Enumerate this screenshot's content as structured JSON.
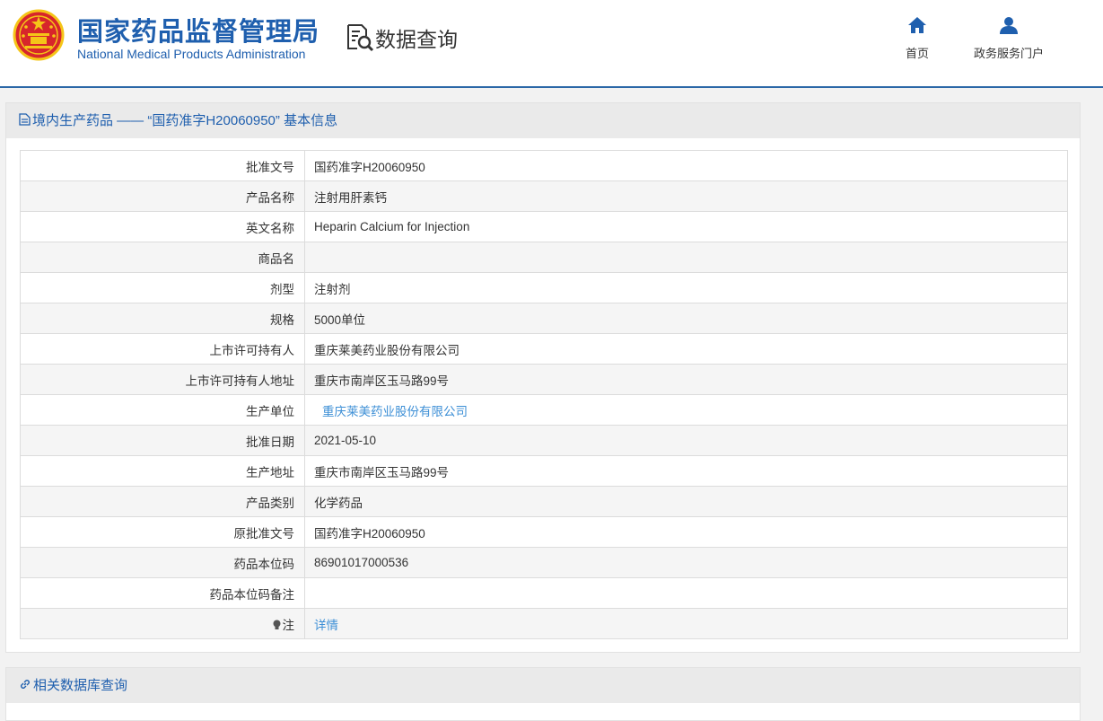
{
  "header": {
    "org_name_cn": "国家药品监督管理局",
    "org_name_en": "National Medical Products Administration",
    "subtitle": "数据查询",
    "nav": [
      {
        "label": "首页",
        "icon": "home-icon"
      },
      {
        "label": "政务服务门户",
        "icon": "user-icon"
      }
    ]
  },
  "detail": {
    "title": "境内生产药品 —— “国药准字H20060950” 基本信息",
    "rows": [
      {
        "label": "批准文号",
        "value": "国药准字H20060950"
      },
      {
        "label": "产品名称",
        "value": "注射用肝素钙"
      },
      {
        "label": "英文名称",
        "value": "Heparin Calcium for Injection"
      },
      {
        "label": "商品名",
        "value": ""
      },
      {
        "label": "剂型",
        "value": "注射剂"
      },
      {
        "label": "规格",
        "value": "5000单位"
      },
      {
        "label": "上市许可持有人",
        "value": "重庆莱美药业股份有限公司"
      },
      {
        "label": "上市许可持有人地址",
        "value": "重庆市南岸区玉马路99号"
      },
      {
        "label": "生产单位",
        "value": "重庆莱美药业股份有限公司"
      },
      {
        "label": "批准日期",
        "value": "2021-05-10"
      },
      {
        "label": "生产地址",
        "value": "重庆市南岸区玉马路99号"
      },
      {
        "label": "产品类别",
        "value": "化学药品"
      },
      {
        "label": "原批准文号",
        "value": "国药准字H20060950"
      },
      {
        "label": "药品本位码",
        "value": "86901017000536"
      },
      {
        "label": "药品本位码备注",
        "value": ""
      },
      {
        "label": "注",
        "value": "详情"
      }
    ]
  },
  "related": {
    "title": "相关数据库查询"
  },
  "colors": {
    "brand_blue": "#1f5fae",
    "link_blue": "#3d8fd6",
    "emblem_red": "#d7262b",
    "emblem_gold": "#f5c518"
  }
}
